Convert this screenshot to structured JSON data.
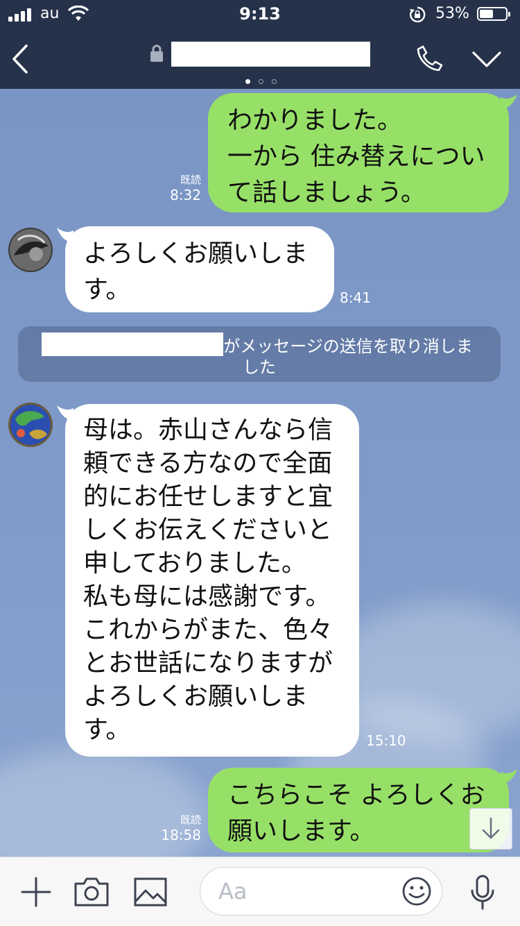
{
  "status_bar": {
    "carrier": "au",
    "time": "9:13",
    "battery_percent": "53%",
    "battery_level": 0.53
  },
  "header": {
    "chat_title": "",
    "page_dots": 3,
    "active_page": 0
  },
  "messages": [
    {
      "side": "me",
      "lines": [
        "わかりました。",
        "一から 住み替えについ",
        "て話しましょう。"
      ],
      "read": "既読",
      "time": "8:32"
    },
    {
      "side": "you",
      "lines": [
        "よろしくお願いしま",
        "す。"
      ],
      "time": "8:41"
    },
    {
      "side": "you",
      "lines": [
        "母は。赤山さんなら信",
        "頼できる方なので全面",
        "的にお任せしますと宜",
        "しくお伝えくださいと",
        "申しておりました。",
        "私も母には感謝です。",
        "これからがまた、色々",
        "とお世話になりますが",
        "よろしくお願いしま",
        "す。"
      ],
      "time": "15:10"
    },
    {
      "side": "me",
      "lines": [
        "こちらこそ よろしくお",
        "願いします。"
      ],
      "read": "既読",
      "time": "18:58"
    }
  ],
  "notice": {
    "line1": "がメッセージの送信を取り消しま",
    "line2": "した"
  },
  "input": {
    "placeholder": "Aa"
  },
  "colors": {
    "header_bg": "#26324a",
    "chat_bg": "#7f9bc8",
    "my_bubble": "#97e067",
    "their_bubble": "#ffffff"
  },
  "icons": [
    "back-icon",
    "lock-icon",
    "phone-icon",
    "chevron-down-icon",
    "plus-icon",
    "camera-icon",
    "image-icon",
    "emoji-icon",
    "microphone-icon",
    "arrow-down-icon"
  ]
}
